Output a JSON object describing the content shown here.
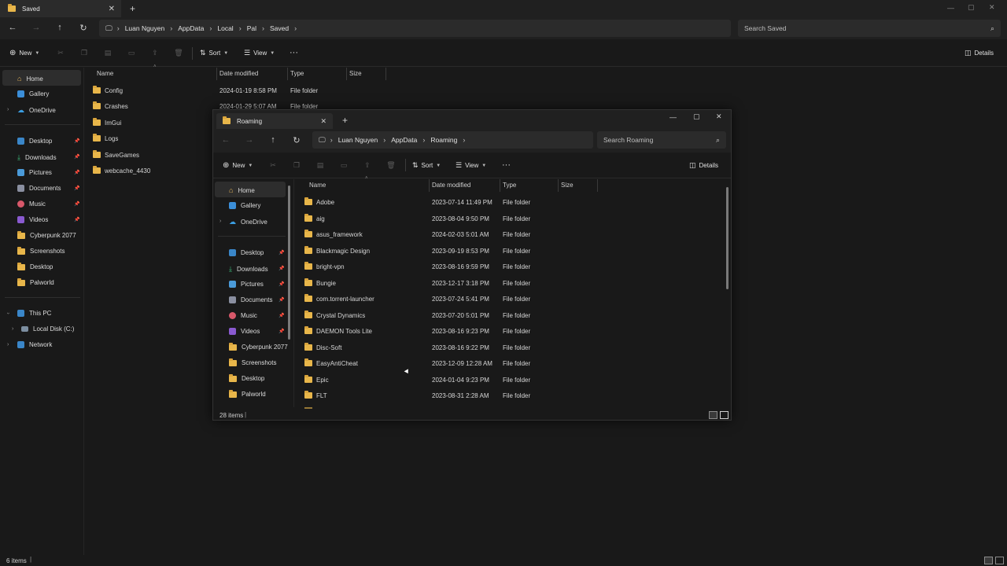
{
  "back": {
    "tab_title": "Saved",
    "breadcrumb": [
      "Luan Nguyen",
      "AppData",
      "Local",
      "Pal",
      "Saved"
    ],
    "search_placeholder": "Search Saved",
    "cmd": {
      "new": "New",
      "sort": "Sort",
      "view": "View",
      "more": "···",
      "details": "Details"
    },
    "nav": {
      "top": [
        {
          "label": "Home",
          "icon": "home-icon"
        },
        {
          "label": "Gallery",
          "icon": "gallery-icon"
        },
        {
          "label": "OneDrive",
          "icon": "cloud-icon"
        }
      ],
      "quick": [
        {
          "label": "Desktop",
          "icon": "desktop-icon",
          "pinned": true
        },
        {
          "label": "Downloads",
          "icon": "download-icon",
          "pinned": true
        },
        {
          "label": "Pictures",
          "icon": "pictures-icon",
          "pinned": true
        },
        {
          "label": "Documents",
          "icon": "documents-icon",
          "pinned": true
        },
        {
          "label": "Music",
          "icon": "music-icon",
          "pinned": true
        },
        {
          "label": "Videos",
          "icon": "videos-icon",
          "pinned": true
        },
        {
          "label": "Cyberpunk 2077",
          "icon": "folder-icon",
          "pinned": false
        },
        {
          "label": "Screenshots",
          "icon": "folder-icon",
          "pinned": false
        },
        {
          "label": "Desktop",
          "icon": "folder-icon",
          "pinned": false
        },
        {
          "label": "Palworld",
          "icon": "folder-icon",
          "pinned": false
        }
      ],
      "bottom": [
        {
          "label": "This PC",
          "icon": "pc-icon"
        },
        {
          "label": "Local Disk (C:)",
          "icon": "disk-icon"
        },
        {
          "label": "Network",
          "icon": "network-icon"
        }
      ]
    },
    "columns": [
      "Name",
      "Date modified",
      "Type",
      "Size"
    ],
    "rows": [
      {
        "name": "Config",
        "date": "2024-01-19 8:58 PM",
        "type": "File folder"
      },
      {
        "name": "Crashes",
        "date": "2024-01-29 5:07 AM",
        "type": "File folder"
      },
      {
        "name": "ImGui",
        "date": "",
        "type": ""
      },
      {
        "name": "Logs",
        "date": "",
        "type": ""
      },
      {
        "name": "SaveGames",
        "date": "",
        "type": ""
      },
      {
        "name": "webcache_4430",
        "date": "",
        "type": ""
      }
    ],
    "status": "6 items"
  },
  "front": {
    "tab_title": "Roaming",
    "breadcrumb": [
      "Luan Nguyen",
      "AppData",
      "Roaming"
    ],
    "search_placeholder": "Search Roaming",
    "cmd": {
      "new": "New",
      "sort": "Sort",
      "view": "View",
      "more": "···",
      "details": "Details"
    },
    "nav": {
      "top": [
        {
          "label": "Home",
          "icon": "home-icon"
        },
        {
          "label": "Gallery",
          "icon": "gallery-icon"
        },
        {
          "label": "OneDrive",
          "icon": "cloud-icon"
        }
      ],
      "quick": [
        {
          "label": "Desktop",
          "icon": "desktop-icon",
          "pinned": true
        },
        {
          "label": "Downloads",
          "icon": "download-icon",
          "pinned": true
        },
        {
          "label": "Pictures",
          "icon": "pictures-icon",
          "pinned": true
        },
        {
          "label": "Documents",
          "icon": "documents-icon",
          "pinned": true
        },
        {
          "label": "Music",
          "icon": "music-icon",
          "pinned": true
        },
        {
          "label": "Videos",
          "icon": "videos-icon",
          "pinned": true
        },
        {
          "label": "Cyberpunk 2077",
          "icon": "folder-icon",
          "pinned": false
        },
        {
          "label": "Screenshots",
          "icon": "folder-icon",
          "pinned": false
        },
        {
          "label": "Desktop",
          "icon": "folder-icon",
          "pinned": false
        },
        {
          "label": "Palworld",
          "icon": "folder-icon",
          "pinned": false
        }
      ]
    },
    "columns": [
      "Name",
      "Date modified",
      "Type",
      "Size"
    ],
    "rows": [
      {
        "name": "Adobe",
        "date": "2023-07-14 11:49 PM",
        "type": "File folder"
      },
      {
        "name": "aig",
        "date": "2023-08-04 9:50 PM",
        "type": "File folder"
      },
      {
        "name": "asus_framework",
        "date": "2024-02-03 5:01 AM",
        "type": "File folder"
      },
      {
        "name": "Blackmagic Design",
        "date": "2023-09-19 8:53 PM",
        "type": "File folder"
      },
      {
        "name": "bright-vpn",
        "date": "2023-08-16 9:59 PM",
        "type": "File folder"
      },
      {
        "name": "Bungie",
        "date": "2023-12-17 3:18 PM",
        "type": "File folder"
      },
      {
        "name": "com.torrent-launcher",
        "date": "2023-07-24 5:41 PM",
        "type": "File folder"
      },
      {
        "name": "Crystal Dynamics",
        "date": "2023-07-20 5:01 PM",
        "type": "File folder"
      },
      {
        "name": "DAEMON Tools Lite",
        "date": "2023-08-16 9:23 PM",
        "type": "File folder"
      },
      {
        "name": "Disc-Soft",
        "date": "2023-08-16 9:22 PM",
        "type": "File folder"
      },
      {
        "name": "EasyAntiCheat",
        "date": "2023-12-09 12:28 AM",
        "type": "File folder"
      },
      {
        "name": "Epic",
        "date": "2024-01-04 9:23 PM",
        "type": "File folder"
      },
      {
        "name": "FLT",
        "date": "2023-08-31 2:28 AM",
        "type": "File folder"
      }
    ],
    "status": "28 items"
  },
  "colors": {
    "folder": "#e8b64a",
    "bg": "#191919",
    "bar": "#202020",
    "field": "#2b2b2b"
  }
}
